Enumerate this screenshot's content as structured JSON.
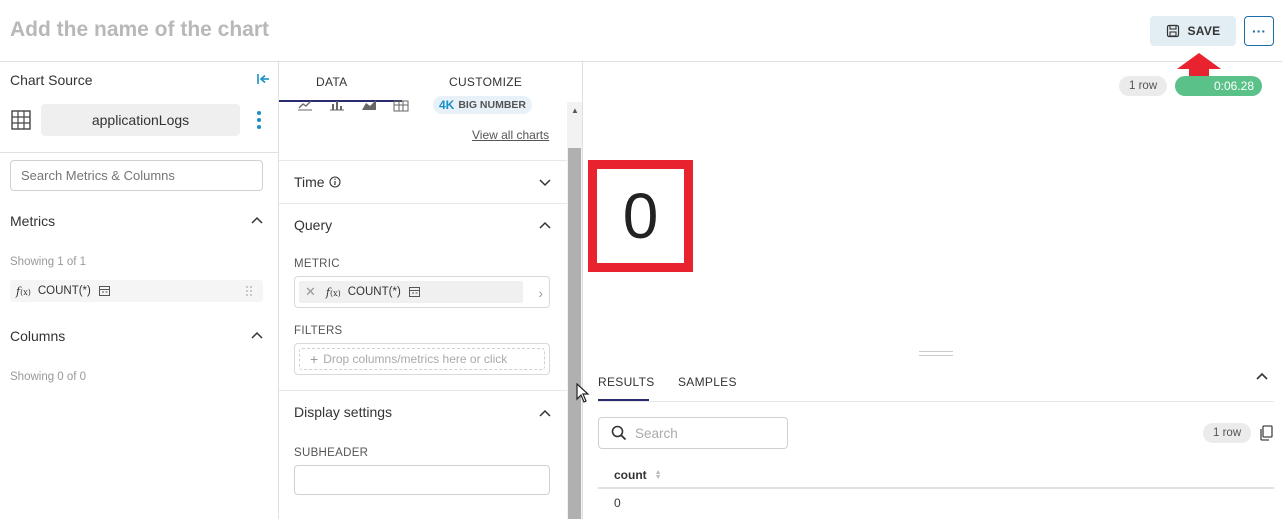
{
  "header": {
    "title_placeholder": "Add the name of the chart",
    "save_label": "SAVE",
    "more_label": "···"
  },
  "left": {
    "chart_source_label": "Chart Source",
    "datasource_name": "applicationLogs",
    "search_placeholder": "Search Metrics & Columns",
    "metrics_label": "Metrics",
    "metrics_showing": "Showing 1 of 1",
    "metric_item": "COUNT(*)",
    "columns_label": "Columns",
    "columns_showing": "Showing 0 of 0"
  },
  "middle": {
    "tabs": [
      {
        "label": "DATA",
        "active": true
      },
      {
        "label": "CUSTOMIZE",
        "active": false
      }
    ],
    "big_number_badge": "BIG NUMBER",
    "big_number_badge_prefix": "4K",
    "view_all_charts": "View all charts",
    "time_label": "Time",
    "query_label": "Query",
    "metric_label": "METRIC",
    "metric_value": "COUNT(*)",
    "filters_label": "FILTERS",
    "filters_placeholder": "Drop columns/metrics here or click",
    "display_settings_label": "Display settings",
    "subheader_label": "SUBHEADER"
  },
  "right": {
    "row_count": "1 row",
    "elapsed_time": "0:06.28",
    "big_number_value": "0",
    "results_tabs": [
      {
        "label": "RESULTS",
        "active": true
      },
      {
        "label": "SAMPLES",
        "active": false
      }
    ],
    "search_placeholder": "Search",
    "results_row_count": "1 row",
    "table": {
      "columns": [
        "count"
      ],
      "rows": [
        [
          "0"
        ]
      ]
    }
  },
  "colors": {
    "accent_blue": "#1a8fc8",
    "highlight_red": "#e8222e",
    "success_green": "#5ac189",
    "tab_underline": "#2a2a6e"
  }
}
